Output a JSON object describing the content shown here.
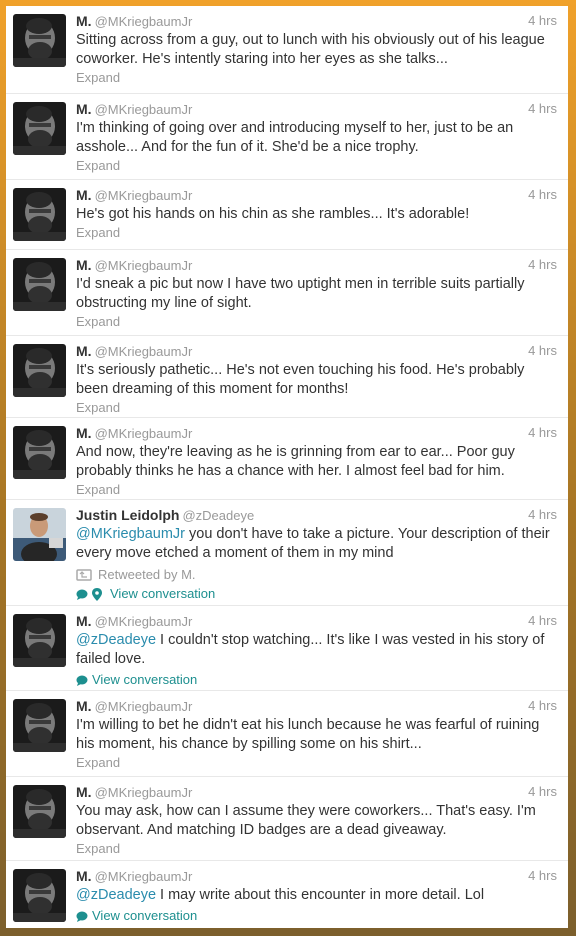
{
  "expand_label": "Expand",
  "view_conversation_label": "View conversation",
  "colors": {
    "mention": "#2a8cad",
    "conversation": "#1d8f8f",
    "border": "#f0a12a"
  },
  "tweets": [
    {
      "name": "M.",
      "handle": "@MKriegbaumJr",
      "time": "4 hrs",
      "text": "Sitting across from a guy, out to lunch with his obviously out of his league coworker. He's intently staring into her eyes as she talks..."
    },
    {
      "name": "M.",
      "handle": "@MKriegbaumJr",
      "time": "4 hrs",
      "text": "I'm thinking of going over and introducing myself to her, just to be an asshole... And for the fun of it. She'd be a nice trophy."
    },
    {
      "name": "M.",
      "handle": "@MKriegbaumJr",
      "time": "4 hrs",
      "text": "He's got his hands on his chin as she rambles... It's adorable!"
    },
    {
      "name": "M.",
      "handle": "@MKriegbaumJr",
      "time": "4 hrs",
      "text": "I'd sneak a pic but now I have two uptight men in terrible suits partially obstructing my line of sight."
    },
    {
      "name": "M.",
      "handle": "@MKriegbaumJr",
      "time": "4 hrs",
      "text": "It's seriously pathetic... He's not even touching his food. He's probably been dreaming of this moment for months!"
    },
    {
      "name": "M.",
      "handle": "@MKriegbaumJr",
      "time": "4 hrs",
      "text": "And now, they're leaving as he is grinning from ear to ear... Poor guy probably thinks he has a chance with her. I almost feel bad for him."
    },
    {
      "name": "Justin Leidolph",
      "handle": "@zDeadeye",
      "time": "4 hrs",
      "mention": "@MKriegbaumJr",
      "text": " you don't have to take a picture. Your description of their every move etched a moment of them in my mind",
      "retweeted_by": "Retweeted by M."
    },
    {
      "name": "M.",
      "handle": "@MKriegbaumJr",
      "time": "4 hrs",
      "mention": "@zDeadeye",
      "text": " I couldn't stop watching... It's like I was vested in his story of failed love."
    },
    {
      "name": "M.",
      "handle": "@MKriegbaumJr",
      "time": "4 hrs",
      "text": "I'm willing to bet he didn't eat his lunch because he was fearful of ruining his moment, his chance by spilling some on his shirt..."
    },
    {
      "name": "M.",
      "handle": "@MKriegbaumJr",
      "time": "4 hrs",
      "text": "You may ask, how can I assume they were coworkers... That's easy. I'm observant. And matching ID badges are a dead giveaway."
    },
    {
      "name": "M.",
      "handle": "@MKriegbaumJr",
      "time": "4 hrs",
      "mention": "@zDeadeye",
      "text": " I may write about this encounter in more detail. Lol"
    }
  ]
}
